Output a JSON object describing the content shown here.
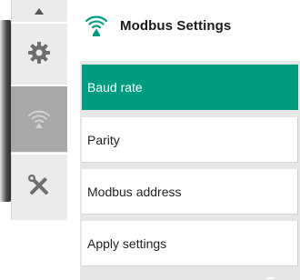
{
  "header": {
    "title": "Modbus Settings",
    "icon": "modbus-wifi-icon",
    "accent_color": "#009c82"
  },
  "sidebar": {
    "items": [
      {
        "icon": "gear-icon"
      },
      {
        "icon": "modbus-wifi-icon",
        "active": true
      },
      {
        "icon": "tools-icon"
      }
    ]
  },
  "menu": {
    "items": [
      {
        "label": "Baud rate",
        "selected": true
      },
      {
        "label": "Parity"
      },
      {
        "label": "Modbus address"
      },
      {
        "label": "Apply settings"
      }
    ],
    "selected_color": "#009c82"
  }
}
